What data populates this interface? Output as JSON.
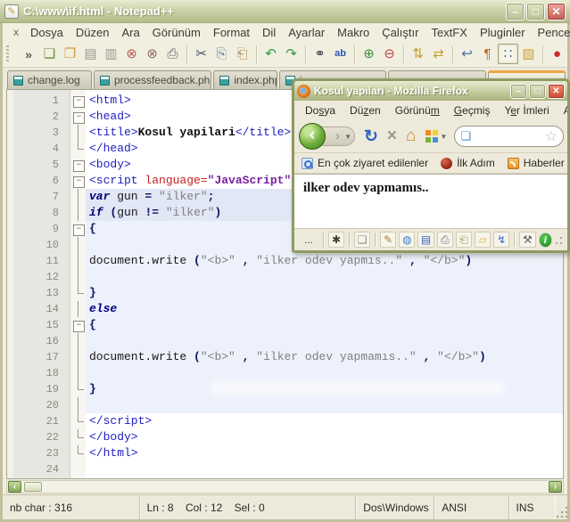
{
  "notepadpp": {
    "title": "C:\\www\\if.html - Notepad++",
    "window_buttons": {
      "minimize": "–",
      "maximize": "□",
      "close": "✕"
    },
    "menu": [
      "Dosya",
      "Düzen",
      "Ara",
      "Görünüm",
      "Format",
      "Dil",
      "Ayarlar",
      "Makro",
      "Çalıştır",
      "TextFX",
      "Pluginler",
      "Pencere",
      "?"
    ],
    "menu_close_label": "x",
    "toolbar_overflow": "»",
    "toolbar": [
      {
        "name": "new-file",
        "glyph": "❏",
        "color": "#6b8f3e"
      },
      {
        "name": "open-file",
        "glyph": "❐",
        "color": "#d19a3d"
      },
      {
        "name": "save-file",
        "glyph": "▤",
        "color": "#9a9a92"
      },
      {
        "name": "save-all",
        "glyph": "▥",
        "color": "#9a9a92"
      },
      {
        "name": "close-file",
        "glyph": "⊗",
        "color": "#b86050"
      },
      {
        "name": "close-all",
        "glyph": "⊗",
        "color": "#8f6f60"
      },
      {
        "name": "print",
        "glyph": "⎙",
        "color": "#5a5f66"
      },
      {
        "sep": true
      },
      {
        "name": "cut",
        "glyph": "✂",
        "color": "#45525f"
      },
      {
        "name": "copy",
        "glyph": "⎘",
        "color": "#7189a8"
      },
      {
        "name": "paste",
        "glyph": "⎗",
        "color": "#b08d52"
      },
      {
        "sep": true
      },
      {
        "name": "undo",
        "glyph": "↶",
        "color": "#2f9a43"
      },
      {
        "name": "redo",
        "glyph": "↷",
        "color": "#2f9a43"
      },
      {
        "sep": true
      },
      {
        "name": "find",
        "glyph": "⚭",
        "color": "#3b4450"
      },
      {
        "name": "replace",
        "glyph": "ab",
        "color": "#2c55b0"
      },
      {
        "sep": true
      },
      {
        "name": "zoom-in",
        "glyph": "⊕",
        "color": "#3e8f3e"
      },
      {
        "name": "zoom-out",
        "glyph": "⊖",
        "color": "#c04545"
      },
      {
        "sep": true
      },
      {
        "name": "sync-vertical-scroll",
        "glyph": "⇅",
        "color": "#c79b2e"
      },
      {
        "name": "sync-horizontal-scroll",
        "glyph": "⇄",
        "color": "#c79b2e"
      },
      {
        "sep": true
      },
      {
        "name": "word-wrap",
        "glyph": "↩",
        "color": "#4a6fae"
      },
      {
        "name": "show-all-characters",
        "glyph": "¶",
        "color": "#b5651d"
      },
      {
        "name": "indent-guide",
        "glyph": "∷",
        "color": "#4a6fae",
        "pressed": true
      },
      {
        "name": "function-list",
        "glyph": "▧",
        "color": "#d1a23d"
      },
      {
        "sep": true
      },
      {
        "name": "record-macro",
        "glyph": "●",
        "color": "#cc2b2b"
      }
    ],
    "tabs": [
      {
        "label": "change.log",
        "width": 96
      },
      {
        "label": "processfeedback.php",
        "width": 134
      },
      {
        "label": "index.php",
        "width": 72
      },
      {
        "label": "i",
        "width": 122
      },
      {
        "label": "",
        "width": 111,
        "ghost": true
      },
      {
        "label": "",
        "width": 88,
        "ghost": true,
        "active": true
      }
    ],
    "editor": {
      "lines": [
        {
          "n": 1,
          "fold": "box",
          "segs": [
            [
              "tag",
              "<html>"
            ]
          ]
        },
        {
          "n": 2,
          "fold": "box",
          "segs": [
            [
              "tag",
              "<head>"
            ]
          ]
        },
        {
          "n": 3,
          "fold": "line",
          "segs": [
            [
              "tag",
              "<title>"
            ],
            [
              "boldtext",
              "Kosul yapilari"
            ],
            [
              "tag",
              "</title>"
            ]
          ]
        },
        {
          "n": 4,
          "fold": "end",
          "segs": [
            [
              "tag",
              "</head>"
            ]
          ]
        },
        {
          "n": 5,
          "fold": "box",
          "segs": [
            [
              "tag",
              "<body>"
            ]
          ]
        },
        {
          "n": 6,
          "fold": "box",
          "segs": [
            [
              "tag",
              "<script "
            ],
            [
              "attr",
              "language="
            ],
            [
              "val",
              "\"JavaScript\""
            ],
            [
              "tag",
              ">"
            ]
          ]
        },
        {
          "n": 7,
          "fold": "line",
          "hl": true,
          "segs": [
            [
              "kw",
              "var"
            ],
            [
              "plain",
              " gun "
            ],
            [
              "punc",
              "="
            ],
            [
              "plain",
              " "
            ],
            [
              "str",
              "\"ilker\""
            ],
            [
              "punc",
              ";"
            ]
          ]
        },
        {
          "n": 8,
          "fold": "line",
          "hl": true,
          "segs": [
            [
              "kw",
              "if"
            ],
            [
              "plain",
              " "
            ],
            [
              "punc",
              "("
            ],
            [
              "plain",
              "gun "
            ],
            [
              "punc",
              "!="
            ],
            [
              "plain",
              " "
            ],
            [
              "str",
              "\"ilker\""
            ],
            [
              "punc",
              ")"
            ]
          ]
        },
        {
          "n": 9,
          "fold": "box",
          "segs": [
            [
              "punc",
              "{"
            ]
          ]
        },
        {
          "n": 10,
          "fold": "line",
          "segs": []
        },
        {
          "n": 11,
          "fold": "line",
          "segs": [
            [
              "plain",
              "document.write "
            ],
            [
              "punc",
              "("
            ],
            [
              "str",
              "\"<b>\""
            ],
            [
              "plain",
              " "
            ],
            [
              "punc",
              ","
            ],
            [
              "plain",
              " "
            ],
            [
              "str",
              "\"ilker odev yapmıs..\""
            ],
            [
              "plain",
              " "
            ],
            [
              "punc",
              ","
            ],
            [
              "plain",
              " "
            ],
            [
              "str",
              "\"</b>\""
            ],
            [
              "punc",
              ")"
            ]
          ]
        },
        {
          "n": 12,
          "fold": "line",
          "segs": []
        },
        {
          "n": 13,
          "fold": "end",
          "segs": [
            [
              "punc",
              "}"
            ]
          ]
        },
        {
          "n": 14,
          "fold": "line",
          "segs": [
            [
              "kw",
              "else"
            ]
          ]
        },
        {
          "n": 15,
          "fold": "box",
          "segs": [
            [
              "punc",
              "{"
            ]
          ]
        },
        {
          "n": 16,
          "fold": "line",
          "segs": []
        },
        {
          "n": 17,
          "fold": "line",
          "segs": [
            [
              "plain",
              "document.write "
            ],
            [
              "punc",
              "("
            ],
            [
              "str",
              "\"<b>\""
            ],
            [
              "plain",
              " "
            ],
            [
              "punc",
              ","
            ],
            [
              "plain",
              " "
            ],
            [
              "str",
              "\"ilker odev yapmamıs..\""
            ],
            [
              "plain",
              " "
            ],
            [
              "punc",
              ","
            ],
            [
              "plain",
              " "
            ],
            [
              "str",
              "\"</b>\""
            ],
            [
              "punc",
              ")"
            ]
          ]
        },
        {
          "n": 18,
          "fold": "line",
          "segs": []
        },
        {
          "n": 19,
          "fold": "end",
          "segs": [
            [
              "punc",
              "}"
            ]
          ]
        },
        {
          "n": 20,
          "fold": "line",
          "segs": []
        },
        {
          "n": 21,
          "fold": "end",
          "segs": [
            [
              "tag",
              "</script>"
            ]
          ]
        },
        {
          "n": 22,
          "fold": "end",
          "segs": [
            [
              "tag",
              "</body>"
            ]
          ]
        },
        {
          "n": 23,
          "fold": "end",
          "segs": [
            [
              "tag",
              "</html>"
            ]
          ]
        },
        {
          "n": 24,
          "fold": "none",
          "segs": []
        }
      ]
    },
    "statusbar": {
      "doc_info": "nb char : 316",
      "cursor_info": "Ln : 8    Col : 12    Sel : 0",
      "eol_format": "Dos\\Windows",
      "encoding": "ANSI",
      "typing_mode": "INS"
    },
    "scrollbar": {
      "left_arrow": "‹",
      "right_arrow": "›"
    }
  },
  "firefox": {
    "title": "Kosul yapilari - Mozilla Firefox",
    "window_buttons": {
      "minimize": "–",
      "maximize": "□",
      "close": "✕"
    },
    "menu": [
      {
        "label": "Dosya",
        "u": 2
      },
      {
        "label": "Düzen",
        "u": 2
      },
      {
        "label": "Görünüm",
        "u": 6
      },
      {
        "label": "Geçmiş",
        "u": 0
      },
      {
        "label": "Yer İmleri",
        "u": 1
      },
      {
        "label": "Araçlar",
        "u": -1
      }
    ],
    "nav": {
      "back": "‹",
      "forward": "›",
      "dropdown": "▼",
      "reload": "↻",
      "stop": "×",
      "home": "⌂",
      "star": "☆",
      "url_text": ""
    },
    "bookmarks": [
      {
        "name": "most-visited",
        "label": "En çok ziyaret edilenler"
      },
      {
        "name": "ilk-adim",
        "label": "İlk Adım"
      },
      {
        "name": "haberler",
        "label": "Haberler"
      }
    ],
    "content_text": "ilker odev yapmamıs..",
    "statusbar": {
      "ellipsis": "...",
      "icons": [
        {
          "name": "bug-extension-icon",
          "glyph": "✱",
          "color": "#4a3b2a",
          "sepAfter": true
        },
        {
          "name": "new-page-icon",
          "glyph": "❏",
          "color": "#8a8a82",
          "sepAfter": true
        },
        {
          "name": "edit-pencil-icon",
          "glyph": "✎",
          "color": "#a5803c"
        },
        {
          "name": "globe-icon",
          "glyph": "◍",
          "color": "#3f7fbf"
        },
        {
          "name": "save-disk-icon",
          "glyph": "▤",
          "color": "#3f5fbf"
        },
        {
          "name": "print-icon",
          "glyph": "⎙",
          "color": "#6a6f76"
        },
        {
          "name": "clipboard-icon",
          "glyph": "⎗",
          "color": "#b08d52"
        },
        {
          "name": "note-icon",
          "glyph": "▱",
          "color": "#d9b23d"
        },
        {
          "name": "lightning-icon",
          "glyph": "↯",
          "color": "#3c63d2",
          "sepAfter": true
        },
        {
          "name": "tools-icon",
          "glyph": "⚒",
          "color": "#5a5f66"
        },
        {
          "name": "info-icon",
          "glyph": "i",
          "round": true
        }
      ]
    }
  }
}
